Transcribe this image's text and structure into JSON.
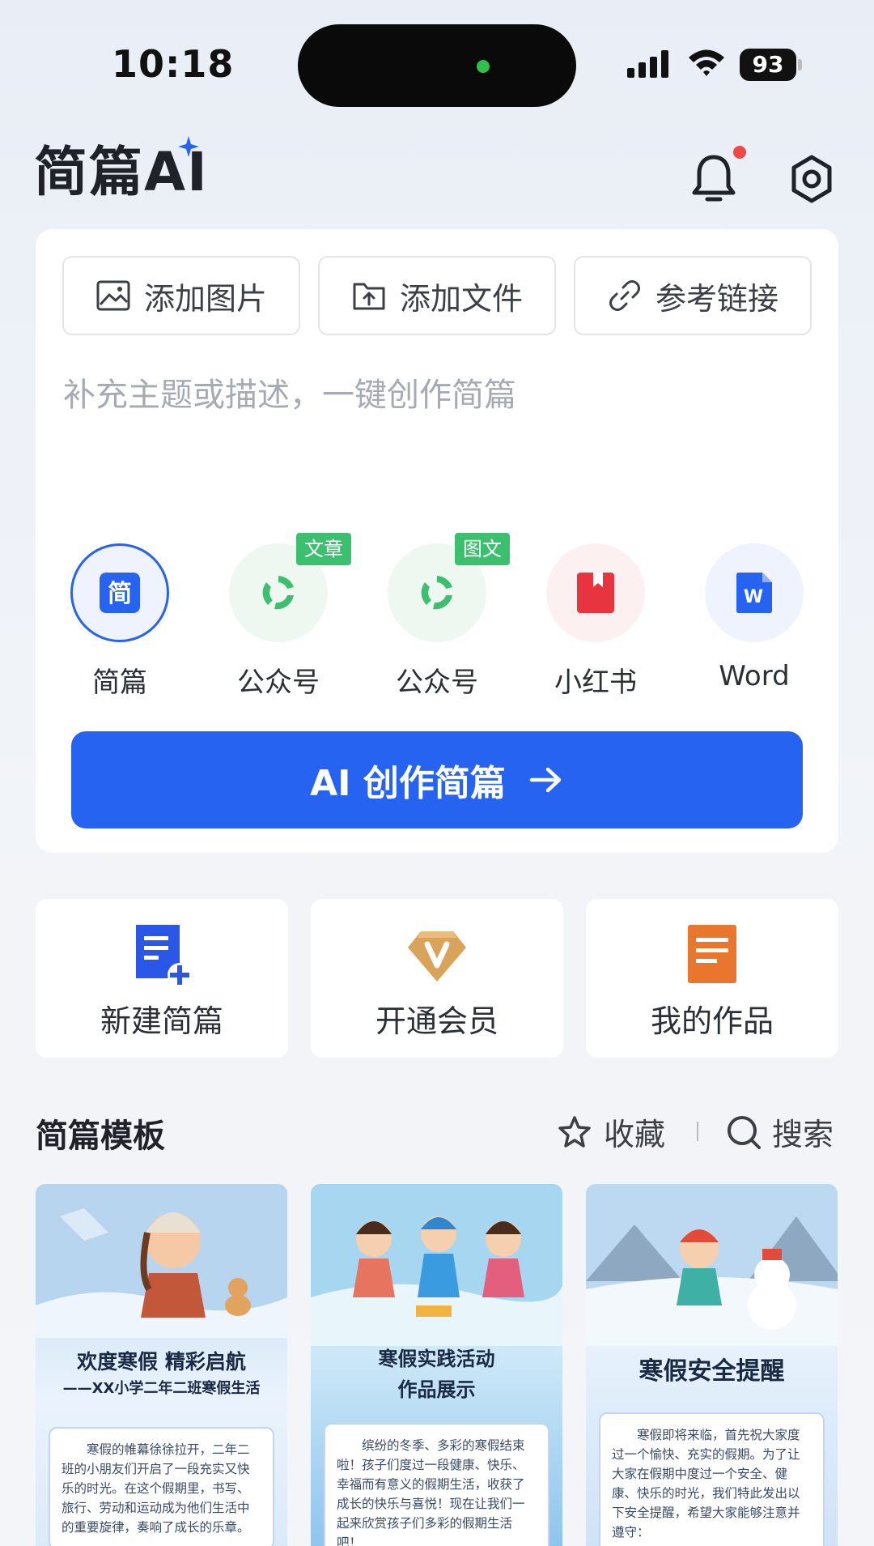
{
  "status_bar": {
    "time": "10:18",
    "battery": "93"
  },
  "header": {
    "logo": "简篇AI"
  },
  "composer": {
    "attach": [
      {
        "label": "添加图片",
        "icon": "image-icon"
      },
      {
        "label": "添加文件",
        "icon": "upload-file-icon"
      },
      {
        "label": "参考链接",
        "icon": "link-icon"
      }
    ],
    "placeholder": "补充主题或描述，一键创作简篇",
    "platforms": [
      {
        "label": "简篇",
        "icon": "jianpian-icon",
        "selected": true
      },
      {
        "label": "公众号",
        "icon": "wechat-official-icon",
        "tag": "文章"
      },
      {
        "label": "公众号",
        "icon": "wechat-official-icon",
        "tag": "图文"
      },
      {
        "label": "小红书",
        "icon": "xiaohongshu-icon"
      },
      {
        "label": "Word",
        "icon": "word-icon"
      }
    ],
    "cta_label": "AI 创作简篇"
  },
  "quick_actions": [
    {
      "label": "新建简篇",
      "icon": "new-doc-icon"
    },
    {
      "label": "开通会员",
      "icon": "vip-icon"
    },
    {
      "label": "我的作品",
      "icon": "my-works-icon"
    }
  ],
  "templates_section": {
    "title": "简篇模板",
    "collect_label": "收藏",
    "search_label": "搜索"
  },
  "templates": [
    {
      "title": "欢度寒假  精彩启航",
      "subtitle": "——XX小学二年二班寒假生活",
      "body": "寒假的帷幕徐徐拉开，二年二班的小朋友们开启了一段充实又快乐的时光。在这个假期里，书写、旅行、劳动和运动成为他们生活中的重要旋律，奏响了成长的乐章。"
    },
    {
      "title": "寒假实践活动",
      "subtitle": "作品展示",
      "body": "缤纷的冬季、多彩的寒假结束啦！孩子们度过一段健康、快乐、幸福而有意义的假期生活，收获了成长的快乐与喜悦！现在让我们一起来欣赏孩子们多彩的假期生活吧！"
    },
    {
      "title": "寒假安全提醒",
      "subtitle": "",
      "body": "寒假即将来临，首先祝大家度过一个愉快、充实的假期。为了让大家在假期中度过一个安全、健康、快乐的时光，我们特此发出以下安全提醒，希望大家能够注意并遵守："
    }
  ],
  "colors": {
    "accent": "#2563f0",
    "tag_green": "#3cbf6e",
    "notify_red": "#f04848"
  }
}
